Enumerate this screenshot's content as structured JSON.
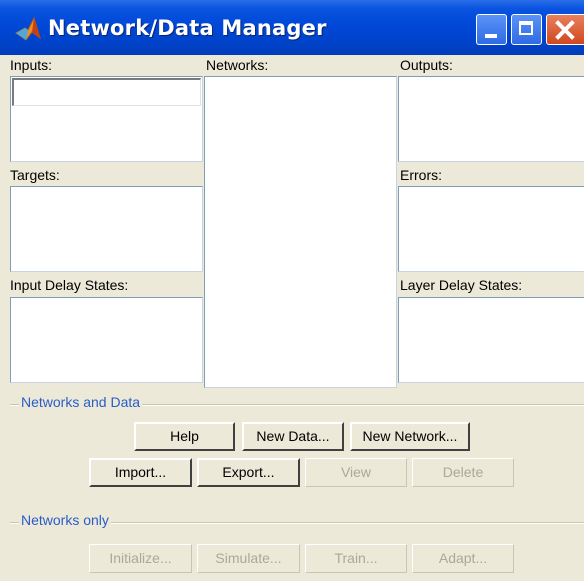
{
  "window": {
    "title": "Network/Data Manager",
    "icon": "matlab-logo-icon"
  },
  "panels": {
    "inputs_label": "Inputs:",
    "networks_label": "Networks:",
    "outputs_label": "Outputs:",
    "targets_label": "Targets:",
    "errors_label": "Errors:",
    "input_delay_label": "Input Delay States:",
    "layer_delay_label": "Layer Delay States:"
  },
  "networks_and_data": {
    "legend": "Networks and Data",
    "help": "Help",
    "new_data": "New Data...",
    "new_network": "New Network...",
    "import": "Import...",
    "export": "Export...",
    "view": "View",
    "delete": "Delete"
  },
  "networks_only": {
    "legend": "Networks only",
    "initialize": "Initialize...",
    "simulate": "Simulate...",
    "train": "Train...",
    "adapt": "Adapt..."
  },
  "colors": {
    "titlebar": "#0048d8",
    "window_bg": "#ece9d8",
    "group_legend": "#2a5cc8",
    "disabled_text": "#aca899"
  }
}
